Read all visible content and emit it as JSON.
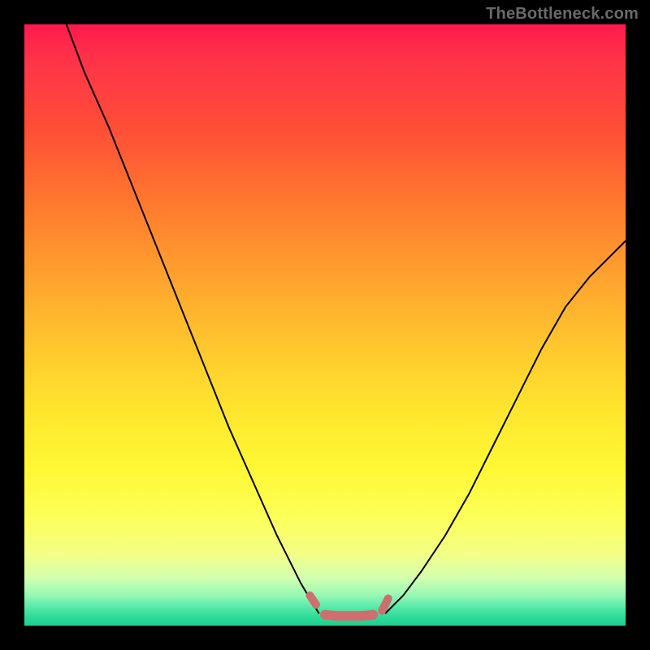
{
  "watermark": "TheBottleneck.com",
  "chart_data": {
    "type": "line",
    "title": "",
    "xlabel": "",
    "ylabel": "",
    "xlim": [
      0,
      100
    ],
    "ylim": [
      0,
      100
    ],
    "grid": false,
    "legend": false,
    "series": [
      {
        "name": "left-arm",
        "stroke": "#000000",
        "stroke_width": 2,
        "x": [
          7,
          10,
          14,
          18,
          22,
          26,
          30,
          34,
          38,
          42,
          46,
          49
        ],
        "y": [
          100,
          92,
          83,
          73,
          63,
          53,
          43,
          33,
          24,
          15,
          7,
          2
        ]
      },
      {
        "name": "right-arm",
        "stroke": "#000000",
        "stroke_width": 2,
        "x": [
          60,
          63,
          66,
          70,
          74,
          78,
          82,
          86,
          90,
          94,
          98,
          100
        ],
        "y": [
          2,
          5,
          9,
          15,
          22,
          30,
          38,
          46,
          53,
          58,
          62,
          64
        ]
      },
      {
        "name": "valley-marker-left-dot",
        "stroke": "#cf6e6e",
        "stroke_width": 10,
        "linecap": "round",
        "x": [
          47.5,
          48.5
        ],
        "y": [
          5.0,
          3.5
        ]
      },
      {
        "name": "valley-marker-floor",
        "stroke": "#cf6e6e",
        "stroke_width": 12,
        "linecap": "round",
        "x": [
          50,
          52,
          54,
          56,
          58
        ],
        "y": [
          1.8,
          1.6,
          1.6,
          1.6,
          1.8
        ]
      },
      {
        "name": "valley-marker-right-dot",
        "stroke": "#cf6e6e",
        "stroke_width": 10,
        "linecap": "round",
        "x": [
          59.5,
          60.5
        ],
        "y": [
          2.5,
          4.5
        ]
      }
    ],
    "background_gradient": {
      "direction": "top-to-bottom",
      "stops": [
        {
          "pos": 0.0,
          "color": "#ff1a4d"
        },
        {
          "pos": 0.3,
          "color": "#ff7a2e"
        },
        {
          "pos": 0.65,
          "color": "#ffe52e"
        },
        {
          "pos": 0.9,
          "color": "#d4ffae"
        },
        {
          "pos": 1.0,
          "color": "#1fd090"
        }
      ]
    }
  }
}
